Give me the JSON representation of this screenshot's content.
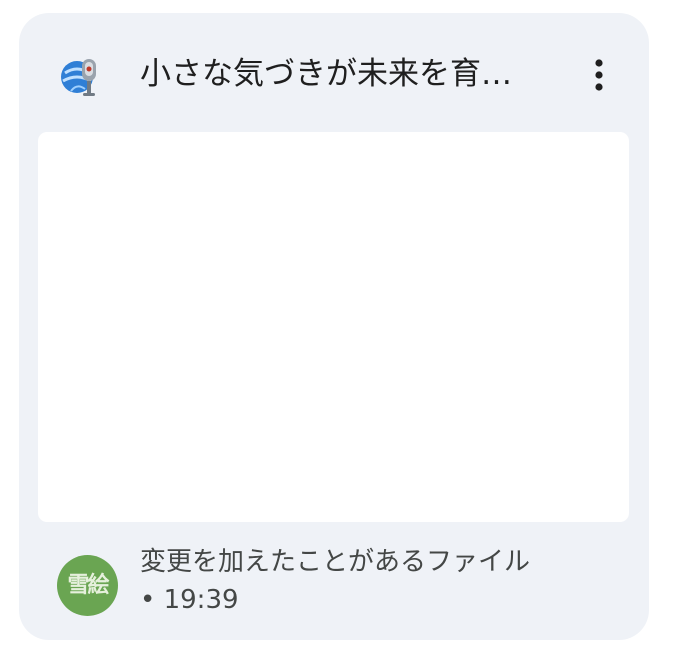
{
  "card": {
    "title": "小さな気づきが未来を育…",
    "app_icon": "microphone-globe-icon",
    "more_icon": "more-vert-icon"
  },
  "footer": {
    "avatar_text": "雪絵",
    "avatar_color": "#6aa552",
    "activity": "変更を加えたことがあるファイル",
    "timestamp": "• 19:39"
  }
}
